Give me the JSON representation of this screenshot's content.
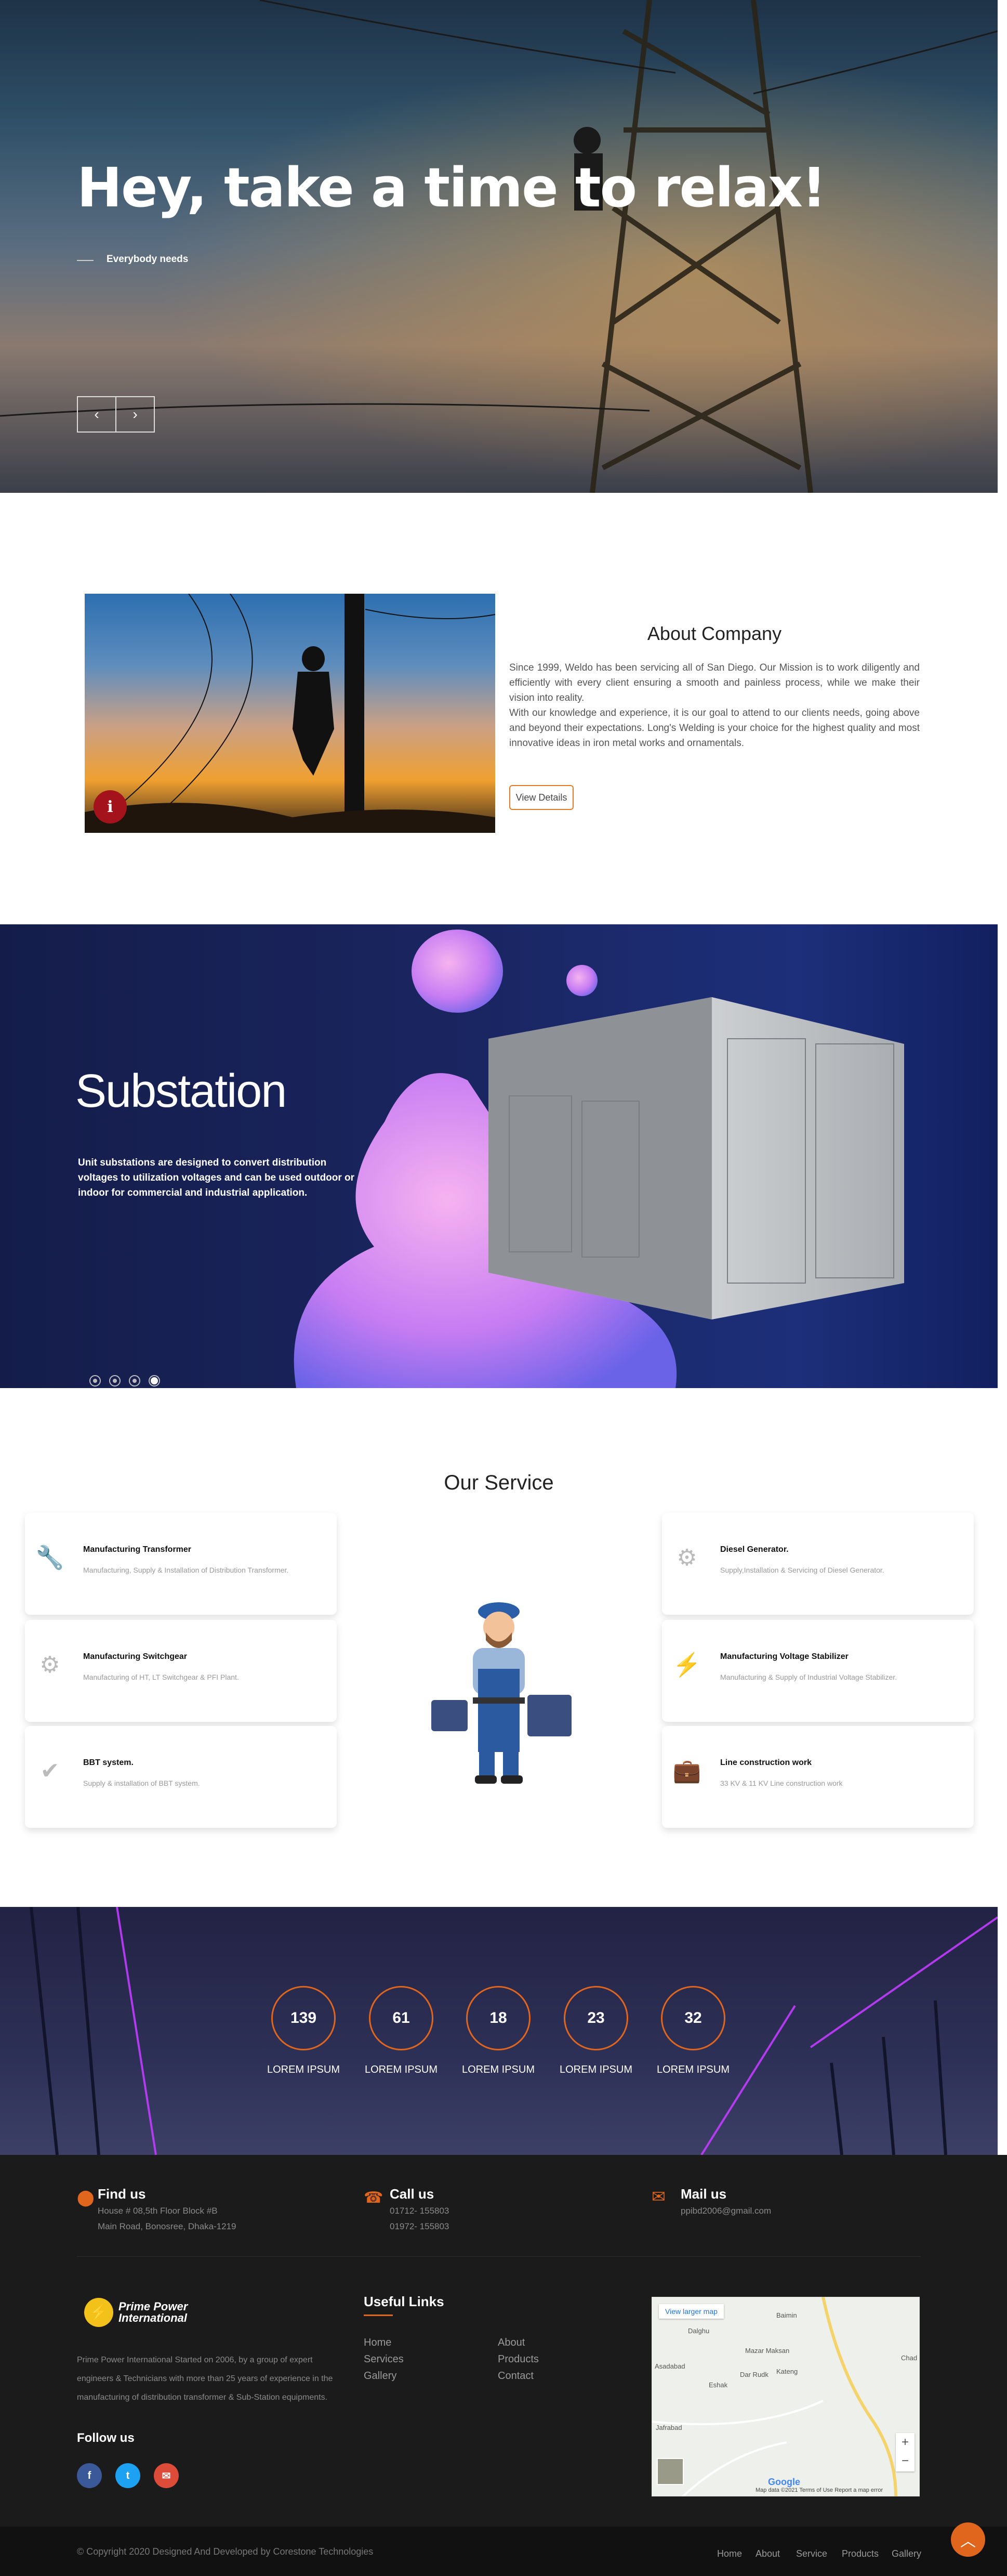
{
  "hero": {
    "title": "Hey, take a time to relax!",
    "tagline": "Everybody needs",
    "prev": "‹",
    "next": "›"
  },
  "about": {
    "title": "About Company",
    "paragraph1": "Since 1999, Weldo has been servicing all of San Diego. Our Mission is to work diligently and efficiently with every client ensuring a smooth and painless process, while we make their vision into reality.",
    "paragraph2": "With our knowledge and experience, it is our goal to attend to our clients needs, going above and beyond their expectations. Long's Welding is your choice for the highest quality and most innovative ideas in iron metal works and ornamentals.",
    "button": "View Details",
    "badge": "i"
  },
  "substation": {
    "title": "Substation",
    "description": "Unit substations are designed to convert distribution voltages to utilization voltages and can be used outdoor or indoor for commercial and industrial application.",
    "slide_count": 4,
    "active_slide": 4
  },
  "services": {
    "title": "Our Service",
    "items": [
      {
        "icon": "wrench-icon",
        "glyph": "🔧",
        "title": "Manufacturing Transformer",
        "desc": "Manufacturing, Supply & Installation of Distribution Transformer."
      },
      {
        "icon": "gear-icon",
        "glyph": "⚙",
        "title": "Manufacturing Switchgear",
        "desc": "Manufacturing of HT, LT Switchgear & PFI Plant."
      },
      {
        "icon": "check-icon",
        "glyph": "✔",
        "title": "BBT system.",
        "desc": "Supply & installation of BBT system."
      },
      {
        "icon": "gears-icon",
        "glyph": "⚙",
        "title": "Diesel Generator.",
        "desc": "Supply,Installation & Servicing of Diesel Generator."
      },
      {
        "icon": "bolt-icon",
        "glyph": "⚡",
        "title": "Manufacturing Voltage Stabilizer",
        "desc": "Manufacturing & Supply of Industrial Voltage Stabilizer."
      },
      {
        "icon": "briefcase-icon",
        "glyph": "💼",
        "title": "Line construction work",
        "desc": "33 KV & 11 KV Line construction work"
      }
    ]
  },
  "stats": [
    {
      "value": "139",
      "label": "LOREM IPSUM"
    },
    {
      "value": "61",
      "label": "LOREM IPSUM"
    },
    {
      "value": "18",
      "label": "LOREM IPSUM"
    },
    {
      "value": "23",
      "label": "LOREM IPSUM"
    },
    {
      "value": "32",
      "label": "LOREM IPSUM"
    }
  ],
  "footer": {
    "find_us": {
      "title": "Find us",
      "line1": "House # 08,5th Floor Block #B",
      "line2": "Main Road, Bonosree, Dhaka-1219"
    },
    "call_us": {
      "title": "Call us",
      "line1": "01712- 155803",
      "line2": "01972- 155803"
    },
    "mail_us": {
      "title": "Mail us",
      "line1": "ppibd2006@gmail.com"
    },
    "logo_text": "Prime Power International",
    "about_text": "Prime Power International Started on 2006, by a group of expert engineers & Technicians with more than 25 years of experience in the manufacturing of distribution transformer & Sub-Station equipments.",
    "follow_us": "Follow us",
    "useful_links_title": "Useful Links",
    "links_col1": [
      "Home",
      "Services",
      "Gallery"
    ],
    "links_col2": [
      "About",
      "Products",
      "Contact"
    ],
    "map": {
      "larger": "View larger map",
      "places": [
        "Dalghu",
        "Mazar Maksan",
        "Baimin",
        "Chad",
        "Asadabad",
        "Dar Rudk",
        "Kateng",
        "Eshak",
        "Jafrabad"
      ],
      "google": "Google",
      "credits": "Map data ©2021  Terms of Use  Report a map error",
      "zoom_in": "+",
      "zoom_out": "−"
    },
    "copyright": "© Copyright 2020 Designed And Developed by Corestone Technologies",
    "bottom_nav": [
      "Home",
      "About",
      "Service",
      "Products",
      "Gallery"
    ]
  },
  "colors": {
    "accent": "#e0661d",
    "footer_bg": "#1b1b1b",
    "facebook": "#3b5998",
    "twitter": "#1da1f2",
    "mail": "#dd4b39"
  }
}
